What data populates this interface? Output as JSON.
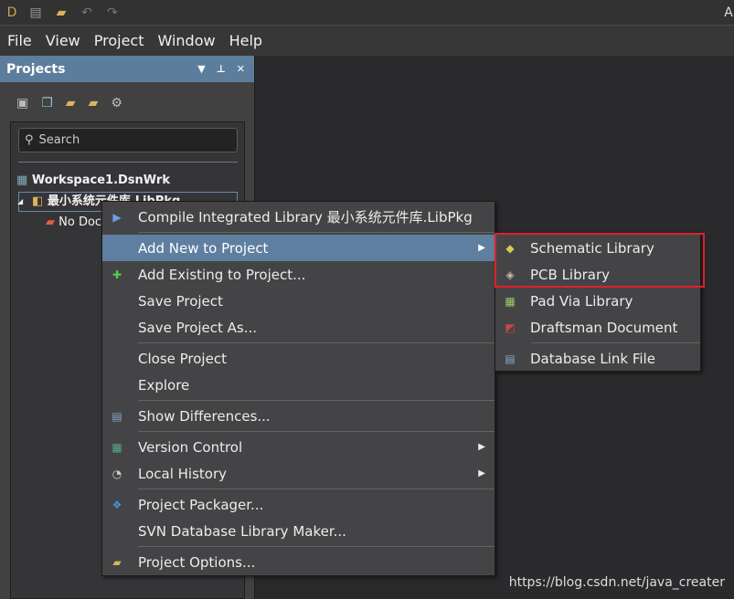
{
  "titlebar": {
    "title_fragment": "A",
    "icons": [
      "app-logo-icon",
      "print-icon",
      "open-folder-icon",
      "undo-icon",
      "redo-icon"
    ]
  },
  "menubar": [
    "File",
    "View",
    "Project",
    "Window",
    "Help"
  ],
  "panel": {
    "title": "Projects",
    "search_placeholder": "Search",
    "workspace": "Workspace1.DsnWrk",
    "project": "最小系统元件库.LibPkg",
    "no_docs": "No Doc"
  },
  "context_menu": [
    {
      "label": "Compile Integrated Library 最小系统元件库.LibPkg",
      "icon": "compile-icon"
    },
    {
      "sep": true
    },
    {
      "label": "Add New to Project",
      "submenu": true,
      "highlighted": true
    },
    {
      "label": "Add Existing to Project...",
      "icon": "add-existing-icon"
    },
    {
      "label": "Save Project"
    },
    {
      "label": "Save Project As..."
    },
    {
      "sep": true
    },
    {
      "label": "Close Project"
    },
    {
      "label": "Explore"
    },
    {
      "sep": true
    },
    {
      "label": "Show Differences...",
      "icon": "differences-icon"
    },
    {
      "sep": true
    },
    {
      "label": "Version Control",
      "icon": "version-control-icon",
      "submenu": true
    },
    {
      "label": "Local History",
      "icon": "history-icon",
      "submenu": true
    },
    {
      "sep": true
    },
    {
      "label": "Project Packager...",
      "icon": "dropbox-icon"
    },
    {
      "label": "SVN Database Library Maker..."
    },
    {
      "sep": true
    },
    {
      "label": "Project Options...",
      "icon": "options-icon"
    }
  ],
  "submenu": [
    {
      "label": "Schematic Library",
      "icon": "schematic-library-icon"
    },
    {
      "label": "PCB Library",
      "icon": "pcb-library-icon"
    },
    {
      "label": "Pad Via Library",
      "icon": "pad-via-library-icon"
    },
    {
      "label": "Draftsman Document",
      "icon": "draftsman-icon"
    },
    {
      "sep": true
    },
    {
      "label": "Database Link File",
      "icon": "database-link-icon"
    }
  ],
  "highlight_color": "#e0202a",
  "watermark": "https://blog.csdn.net/java_creater"
}
